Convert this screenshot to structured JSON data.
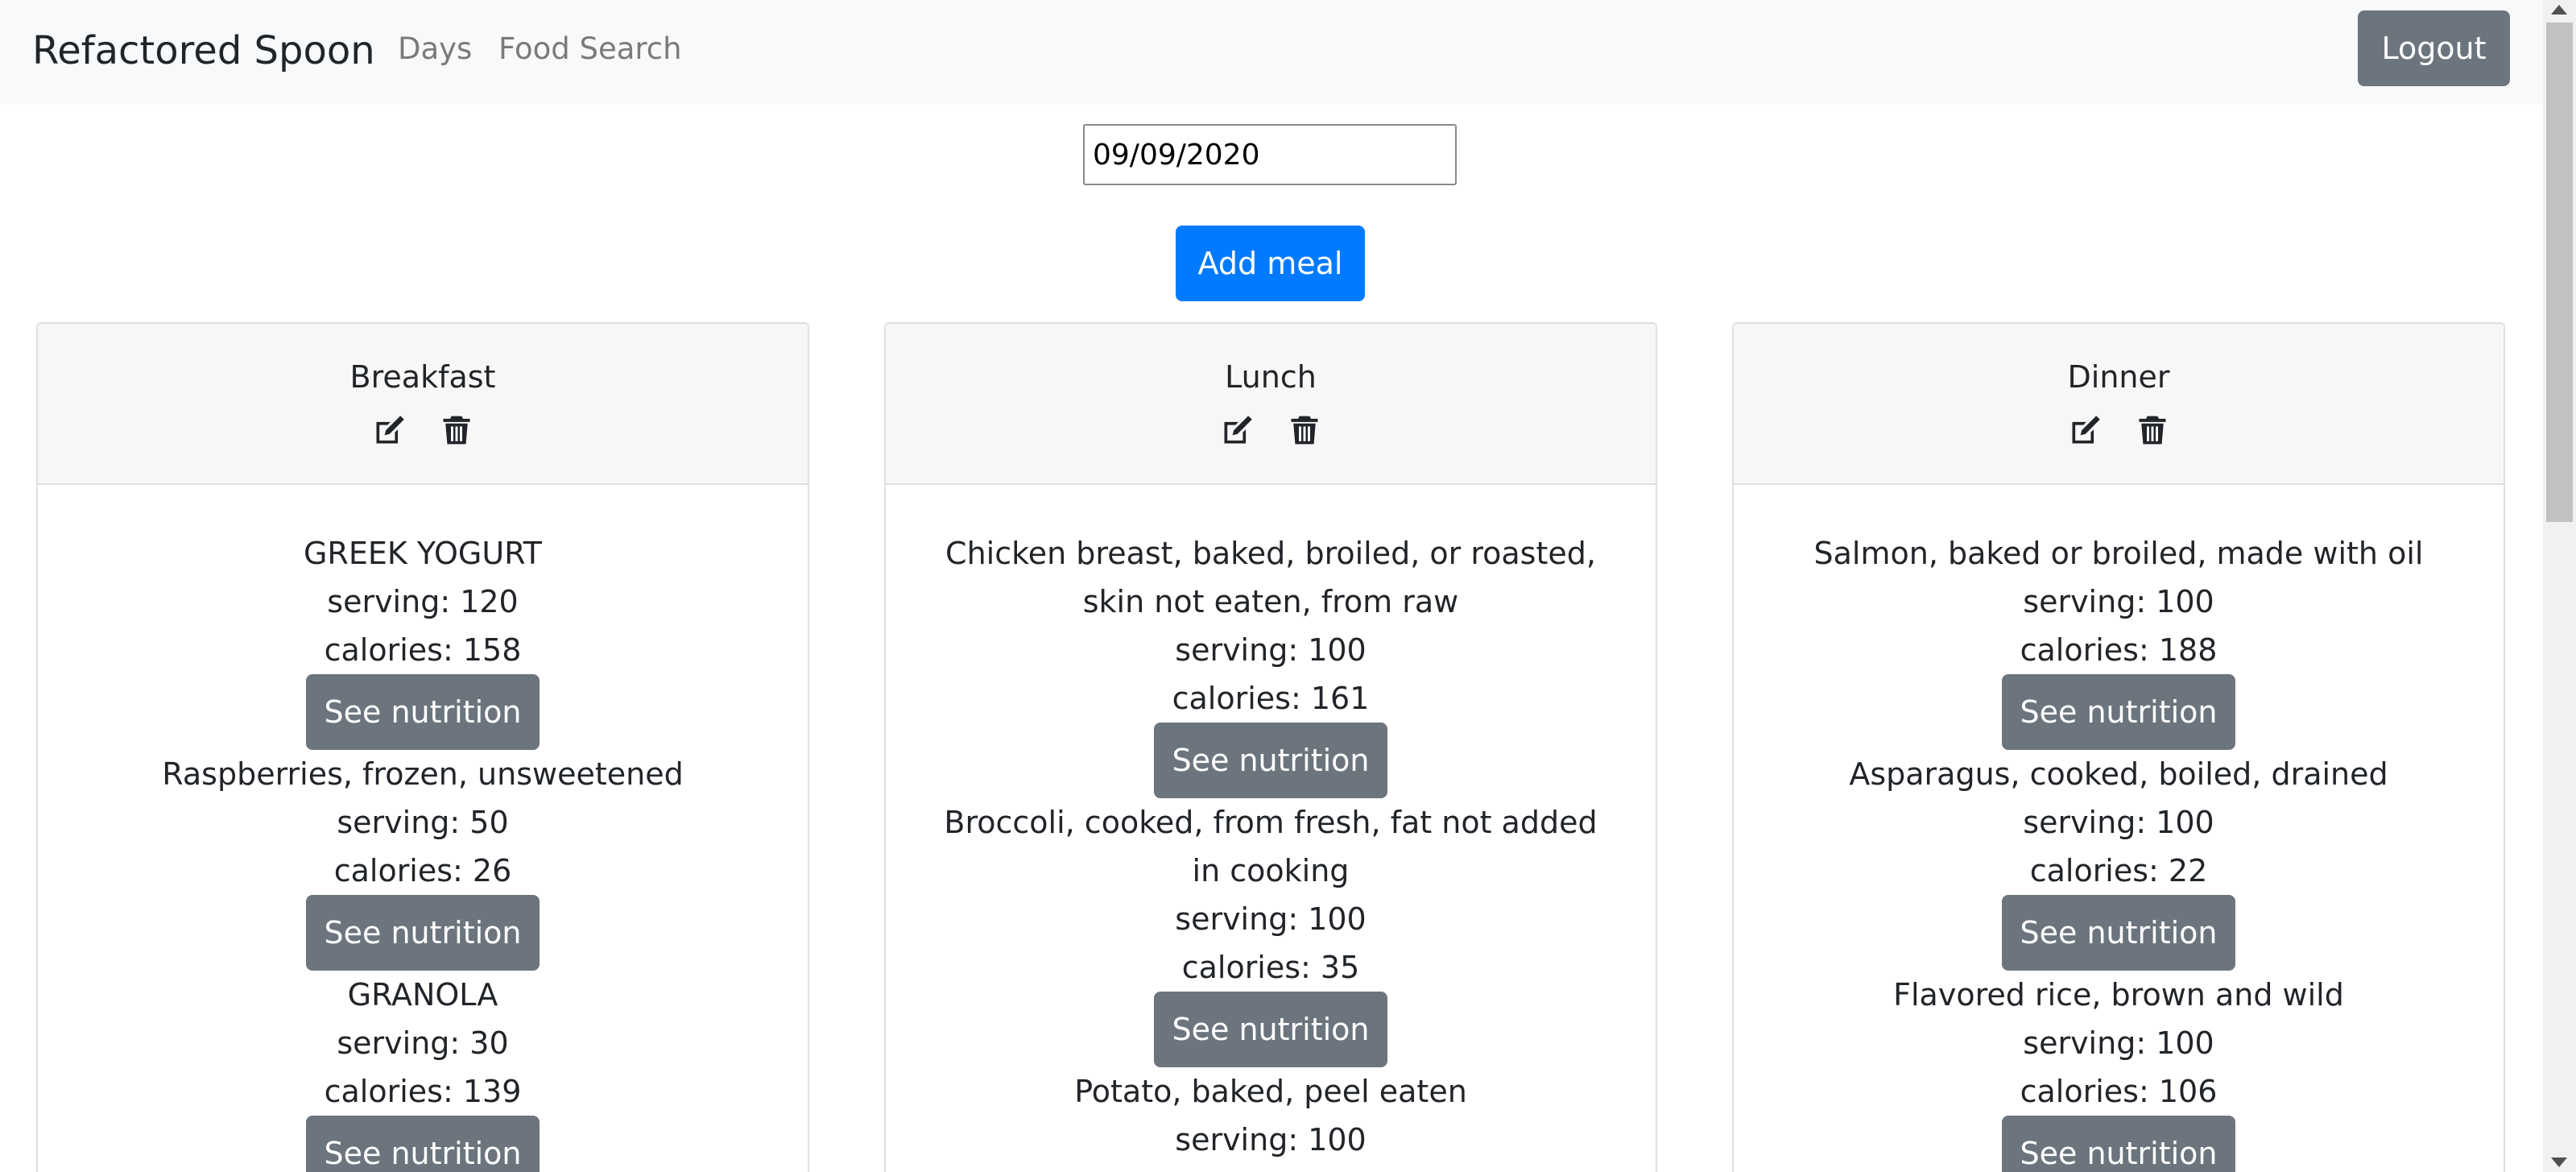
{
  "navbar": {
    "brand": "Refactored Spoon",
    "links": [
      "Days",
      "Food Search"
    ],
    "logout_label": "Logout"
  },
  "date_input": {
    "value": "09/09/2020"
  },
  "add_meal_label": "Add meal",
  "meals": [
    {
      "title": "Breakfast",
      "foods": [
        {
          "name": "GREEK YOGURT",
          "serving": "serving: 120",
          "calories": "calories: 158",
          "button": "See nutrition"
        },
        {
          "name": "Raspberries, frozen, unsweetened",
          "serving": "serving: 50",
          "calories": "calories: 26",
          "button": "See nutrition"
        },
        {
          "name": "GRANOLA",
          "serving": "serving: 30",
          "calories": "calories: 139",
          "button": "See nutrition"
        }
      ]
    },
    {
      "title": "Lunch",
      "foods": [
        {
          "name": "Chicken breast, baked, broiled, or roasted, skin not eaten, from raw",
          "serving": "serving: 100",
          "calories": "calories: 161",
          "button": "See nutrition"
        },
        {
          "name": "Broccoli, cooked, from fresh, fat not added in cooking",
          "serving": "serving: 100",
          "calories": "calories: 35",
          "button": "See nutrition"
        },
        {
          "name": "Potato, baked, peel eaten",
          "serving": "serving: 100",
          "calories": "",
          "button": ""
        }
      ]
    },
    {
      "title": "Dinner",
      "foods": [
        {
          "name": "Salmon, baked or broiled, made with oil",
          "serving": "serving: 100",
          "calories": "calories: 188",
          "button": "See nutrition"
        },
        {
          "name": "Asparagus, cooked, boiled, drained",
          "serving": "serving: 100",
          "calories": "calories: 22",
          "button": "See nutrition"
        },
        {
          "name": "Flavored rice, brown and wild",
          "serving": "serving: 100",
          "calories": "calories: 106",
          "button": "See nutrition"
        }
      ]
    }
  ],
  "icons": {
    "edit": "edit-icon",
    "delete": "trash-icon"
  },
  "colors": {
    "primary": "#007bff",
    "secondary": "#6c757d",
    "navbar_bg": "#f8f9fa"
  }
}
